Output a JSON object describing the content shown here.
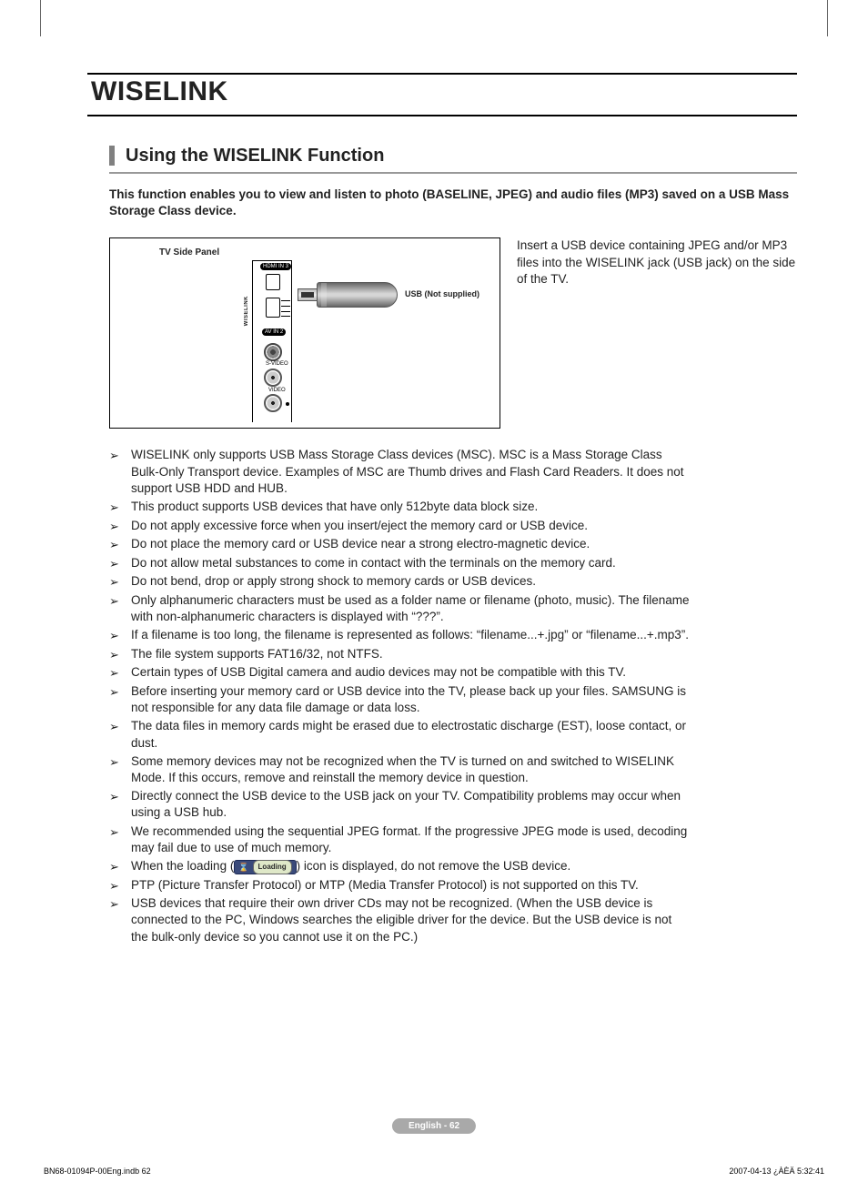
{
  "title": "WISELINK",
  "subheading": "Using the WISELINK Function",
  "intro": "This function enables you to view and listen to photo (BASELINE, JPEG) and audio files (MP3) saved on a USB Mass Storage Class device.",
  "figure": {
    "panel_caption": "TV Side Panel",
    "usb_caption": "USB (Not supplied)",
    "port_hdmi": "HDMI IN 3",
    "port_wiselink": "WISELINK",
    "port_avin": "AV IN 2",
    "port_svideo": "S-VIDEO",
    "port_video": "VIDEO"
  },
  "side_text": "Insert a USB device containing JPEG and/or MP3 files into the WISELINK jack (USB jack) on the side of the TV.",
  "notes": [
    "WISELINK only supports USB Mass Storage Class devices (MSC). MSC is a Mass Storage Class Bulk-Only Transport device. Examples of MSC are Thumb drives and Flash Card Readers. It does not support USB HDD and HUB.",
    "This product supports USB devices that have only 512byte data block size.",
    "Do not apply excessive force when you insert/eject the memory card or USB device.",
    "Do not place the memory card or USB device near a strong electro-magnetic device.",
    "Do not allow metal substances to come in contact with the terminals on the memory card.",
    "Do not bend, drop or apply strong shock to memory cards or USB devices.",
    "Only alphanumeric characters must be used as a folder name or filename (photo, music). The filename with non-alphanumeric characters is displayed with “???”.",
    "If a filename is too long, the filename is represented as follows: “filename...+.jpg” or “filename...+.mp3”.",
    "The file system supports FAT16/32, not NTFS.",
    "Certain types of USB Digital camera and audio devices may not be compatible with this TV.",
    "Before inserting your memory card or USB device into the TV, please back up your files. SAMSUNG is not responsible for any data file damage or data loss.",
    "The data files in memory cards might be erased due to electrostatic discharge (EST), loose contact, or dust.",
    "Some memory devices may not be recognized when the TV is turned on and switched to WISELINK Mode. If this occurs, remove and reinstall the memory device in question.",
    "Directly connect the USB device to the USB jack on your TV. Compatibility problems may occur when using a USB hub.",
    "We recommended using the sequential JPEG format. If the progressive JPEG mode is used, decoding may fail due to use of much memory."
  ],
  "loading_note_pre": "When the loading (",
  "loading_note_post": ") icon is displayed, do not remove the USB device.",
  "loading_label": "Loading",
  "notes_tail": [
    "PTP (Picture Transfer Protocol) or MTP (Media Transfer Protocol) is not supported on this TV.",
    "USB devices that require their own driver CDs may not be recognized. (When the USB device is connected to the PC, Windows searches the eligible driver for the device. But the USB device is not the bulk-only device so you cannot use it on the PC.)"
  ],
  "footer_pill": "English - 62",
  "meta_left": "BN68-01094P-00Eng.indb   62",
  "meta_right": "2007-04-13   ¿ÀÈÄ 5:32:41"
}
